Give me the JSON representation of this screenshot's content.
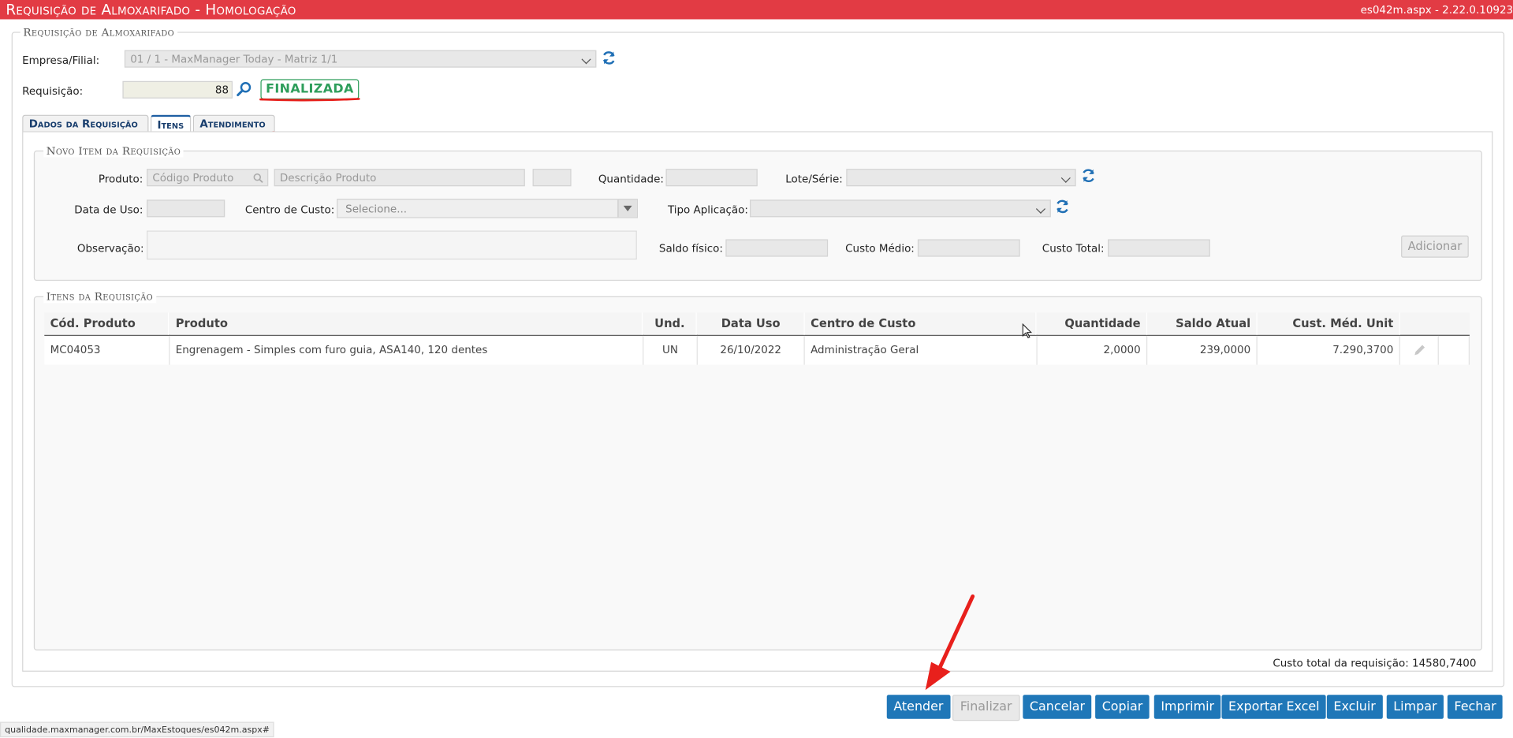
{
  "header": {
    "title_main": "Requisição de Almoxarifado",
    "title_sep": " - ",
    "title_env": "Homologação",
    "version": "es042m.aspx - 2.22.0.10923"
  },
  "form": {
    "legend": "Requisição de Almoxarifado",
    "empresa_label": "Empresa/Filial:",
    "empresa_value": "01 / 1 - MaxManager Today - Matriz 1/1",
    "requisicao_label": "Requisição:",
    "requisicao_value": "88",
    "status_badge": "FINALIZADA"
  },
  "tabs": [
    {
      "label": "Dados da Requisição"
    },
    {
      "label": "Itens"
    },
    {
      "label": "Atendimento"
    }
  ],
  "novo_item": {
    "legend": "Novo Item da Requisição",
    "produto_label": "Produto:",
    "codigo_placeholder": "Código Produto",
    "descricao_placeholder": "Descrição Produto",
    "quantidade_label": "Quantidade:",
    "lote_label": "Lote/Série:",
    "data_uso_label": "Data de Uso:",
    "centro_custo_label": "Centro de Custo:",
    "centro_custo_value": "Selecione...",
    "tipo_aplicacao_label": "Tipo Aplicação:",
    "observacao_label": "Observação:",
    "saldo_fisico_label": "Saldo físico:",
    "custo_medio_label": "Custo Médio:",
    "custo_total_label": "Custo Total:",
    "adicionar_label": "Adicionar"
  },
  "itens": {
    "legend": "Itens da Requisição",
    "columns": [
      "Cód. Produto",
      "Produto",
      "Und.",
      "Data Uso",
      "Centro de Custo",
      "Quantidade",
      "Saldo Atual",
      "Cust. Méd. Unit"
    ],
    "rows": [
      {
        "codigo": "MC04053",
        "produto": "Engrenagem - Simples com furo guia, ASA140, 120 dentes",
        "und": "UN",
        "data_uso": "26/10/2022",
        "centro_custo": "Administração Geral",
        "quantidade": "2,0000",
        "saldo_atual": "239,0000",
        "custo_medio_unit": "7.290,3700"
      }
    ]
  },
  "footer": {
    "custo_total_label": "Custo total da requisição:",
    "custo_total_value": "14580,7400"
  },
  "actions": {
    "atender": "Atender",
    "finalizar": "Finalizar",
    "cancelar": "Cancelar",
    "copiar": "Copiar",
    "imprimir": "Imprimir",
    "exportar_excel": "Exportar Excel",
    "excluir": "Excluir",
    "limpar": "Limpar",
    "fechar": "Fechar"
  },
  "statusbar": {
    "url": "qualidade.maxmanager.com.br/MaxEstoques/es042m.aspx#"
  },
  "colors": {
    "titlebar": "#e23b44",
    "button": "#1f77b8",
    "badge_green": "#2e9e5b",
    "annotation_red": "#e8201c"
  }
}
